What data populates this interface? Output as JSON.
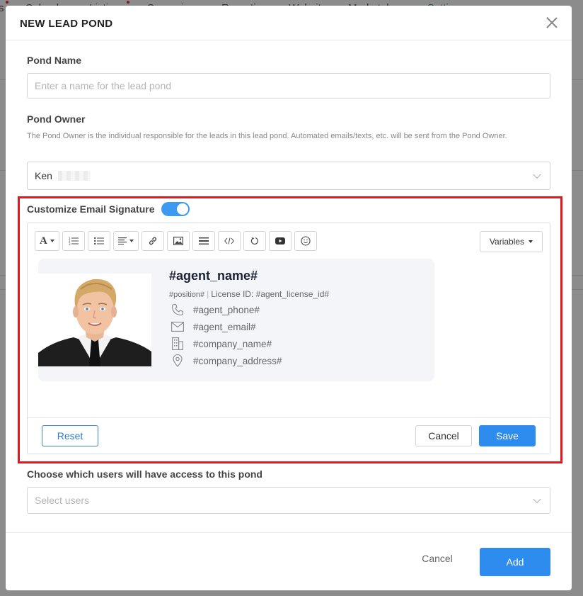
{
  "background": {
    "nav": [
      {
        "label": "Listings",
        "dot": true
      },
      {
        "label": "Calendar",
        "dot": false
      },
      {
        "label": "Listings",
        "dot": true
      },
      {
        "label": "Campaigns",
        "dot": false
      },
      {
        "label": "Reporting",
        "dot": false
      },
      {
        "label": "Website",
        "dot": false
      },
      {
        "label": "Marketplace",
        "dot": false
      },
      {
        "label": "Settings",
        "dot": false,
        "active": true
      }
    ]
  },
  "modal": {
    "title": "NEW LEAD POND",
    "pond_name": {
      "label": "Pond Name",
      "placeholder": "Enter a name for the lead pond",
      "value": ""
    },
    "pond_owner": {
      "label": "Pond Owner",
      "help": "The Pond Owner is the individual responsible for the leads in this lead pond. Automated emails/texts, etc. will be sent from the Pond Owner.",
      "value": "Ken"
    },
    "signature": {
      "toggle_label": "Customize Email Signature",
      "toggle_on": true,
      "variables_label": "Variables",
      "toolbar": [
        "font-icon",
        "ordered-list-icon",
        "unordered-list-icon",
        "align-icon",
        "link-icon",
        "image-icon",
        "horizontal-rule-icon",
        "code-icon",
        "undo-icon",
        "video-icon",
        "emoji-icon"
      ],
      "card": {
        "agent_name": "#agent_name#",
        "position": "#position#",
        "separator": "|",
        "license": "License ID: #agent_license_id#",
        "phone": "#agent_phone#",
        "email": "#agent_email#",
        "company": "#company_name#",
        "address": "#company_address#"
      },
      "reset_label": "Reset",
      "cancel_label": "Cancel",
      "save_label": "Save"
    },
    "users": {
      "label": "Choose which users will have access to this pond",
      "placeholder": "Select users"
    },
    "footer": {
      "cancel_label": "Cancel",
      "add_label": "Add"
    }
  },
  "colors": {
    "primary": "#2f8cef",
    "highlight": "#e0181f",
    "toggle": "#3d9af1"
  }
}
